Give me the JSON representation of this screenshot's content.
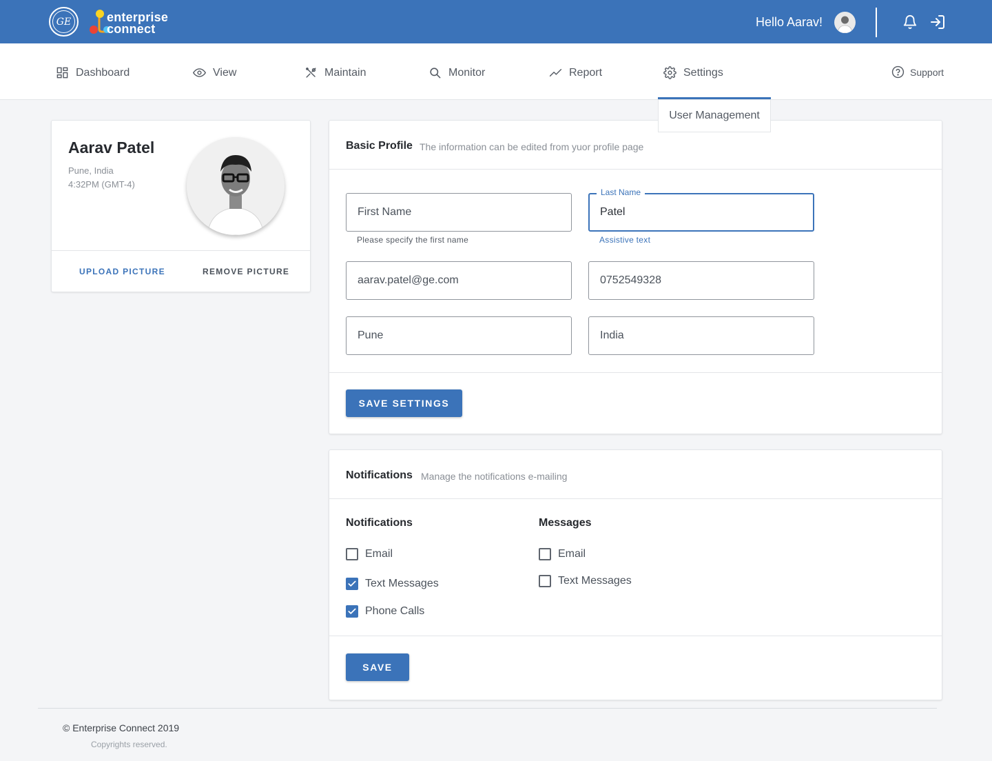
{
  "header": {
    "brand_line1": "enterprise",
    "brand_line2": "connect",
    "ge_mark": "GE",
    "greeting": "Hello Aarav!",
    "colors": {
      "bar": "#3b73b9",
      "accent": "#3b73b9"
    },
    "icons": [
      "ge-logo-icon",
      "enterprise-connect-logo-icon",
      "avatar",
      "bell-icon",
      "logout-icon"
    ]
  },
  "nav": {
    "items": [
      {
        "label": "Dashboard",
        "icon": "dashboard-grid-icon"
      },
      {
        "label": "View",
        "icon": "eye-icon"
      },
      {
        "label": "Maintain",
        "icon": "tools-icon"
      },
      {
        "label": "Monitor",
        "icon": "search-icon"
      },
      {
        "label": "Report",
        "icon": "trend-line-icon"
      },
      {
        "label": "Settings",
        "icon": "gear-icon"
      }
    ],
    "support": "Support",
    "active": "Settings",
    "submenu": "User Management"
  },
  "profile": {
    "name": "Aarav Patel",
    "location": "Pune, India",
    "time": "4:32PM (GMT-4)",
    "upload_label": "UPLOAD PICTURE",
    "remove_label": "REMOVE PICTURE"
  },
  "basic_profile": {
    "title": "Basic Profile",
    "subtitle": "The information can be edited from yuor profile page",
    "first_name_placeholder": "First Name",
    "first_name_helper": "Please specify the first name",
    "last_name_label": "Last Name",
    "last_name_value": "Patel",
    "last_name_helper": "Assistive text",
    "email_value": "aarav.patel@ge.com",
    "phone_value": "0752549328",
    "city_value": "Pune",
    "country_value": "India",
    "save_label": "SAVE SETTINGS"
  },
  "notifications": {
    "title": "Notifications",
    "subtitle": "Manage the notifications e-mailing",
    "col1_title": "Notifications",
    "col1_items": [
      {
        "label": "Email",
        "checked": false
      },
      {
        "label": "Text Messages",
        "checked": true
      },
      {
        "label": "Phone Calls",
        "checked": true
      }
    ],
    "col2_title": "Messages",
    "col2_items": [
      {
        "label": "Email",
        "checked": false
      },
      {
        "label": "Text Messages",
        "checked": false
      }
    ],
    "save_label": "SAVE"
  },
  "footer": {
    "copyright": "© Enterprise Connect 2019",
    "reserved": "Copyrights reserved."
  }
}
